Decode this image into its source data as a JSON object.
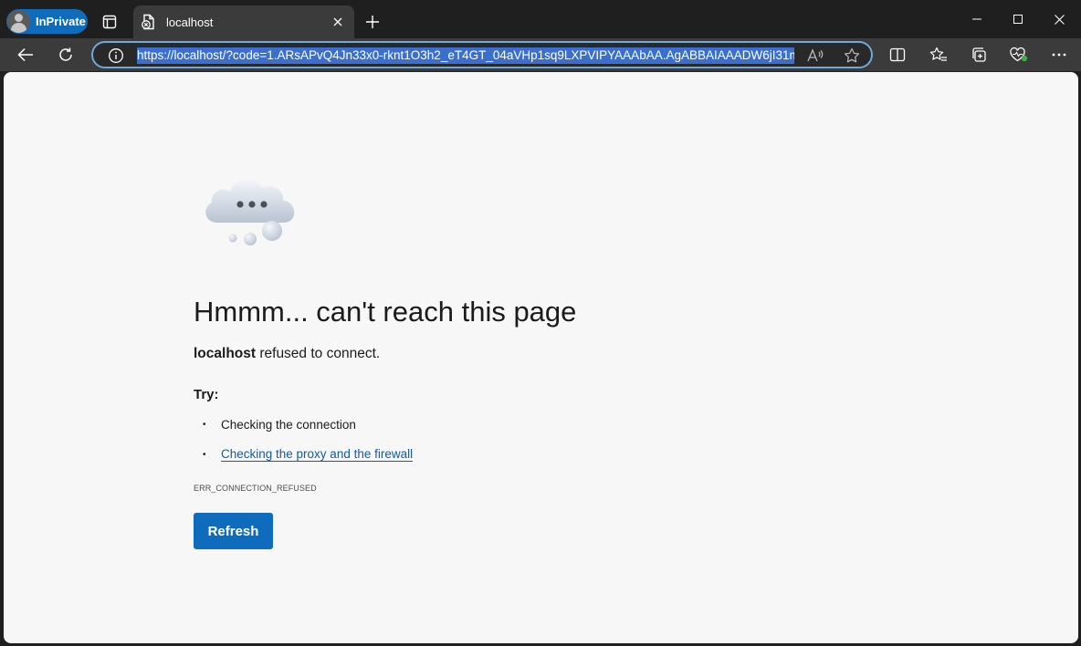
{
  "browser": {
    "profile_label": "InPrivate",
    "tab": {
      "title": "localhost"
    },
    "address": {
      "url": "https://localhost/?code=1.ARsAPvQ4Jn33x0-rknt1O3h2_eT4GT_04aVHp1sq9LXPVIPYAAAbAA.AgABBAIAAADW6jI31m"
    },
    "icons": {
      "tab_actions": "tab-actions-icon",
      "new_tab": "plus-icon",
      "back": "back-arrow-icon",
      "refresh": "refresh-icon",
      "info": "info-icon",
      "read_aloud": "read-aloud-icon",
      "favorite": "star-icon",
      "split_screen": "split-screen-icon",
      "favorites": "favorites-icon",
      "collections": "collections-icon",
      "browser_essentials": "heartbeat-icon",
      "more": "more-icon"
    }
  },
  "page": {
    "heading": "Hmmm... can't reach this page",
    "host": "localhost",
    "refused_text": " refused to connect.",
    "try_label": "Try:",
    "suggestions": [
      {
        "text": "Checking the connection",
        "link": false
      },
      {
        "text": "Checking the proxy and the firewall",
        "link": true
      }
    ],
    "error_code": "ERR_CONNECTION_REFUSED",
    "refresh_label": "Refresh"
  },
  "colors": {
    "accent": "#0f6cbd",
    "link": "#0f5da8",
    "chrome_dark": "#1f1f1f",
    "toolbar": "#3b3b3b",
    "page_bg": "#f7f7f7"
  }
}
